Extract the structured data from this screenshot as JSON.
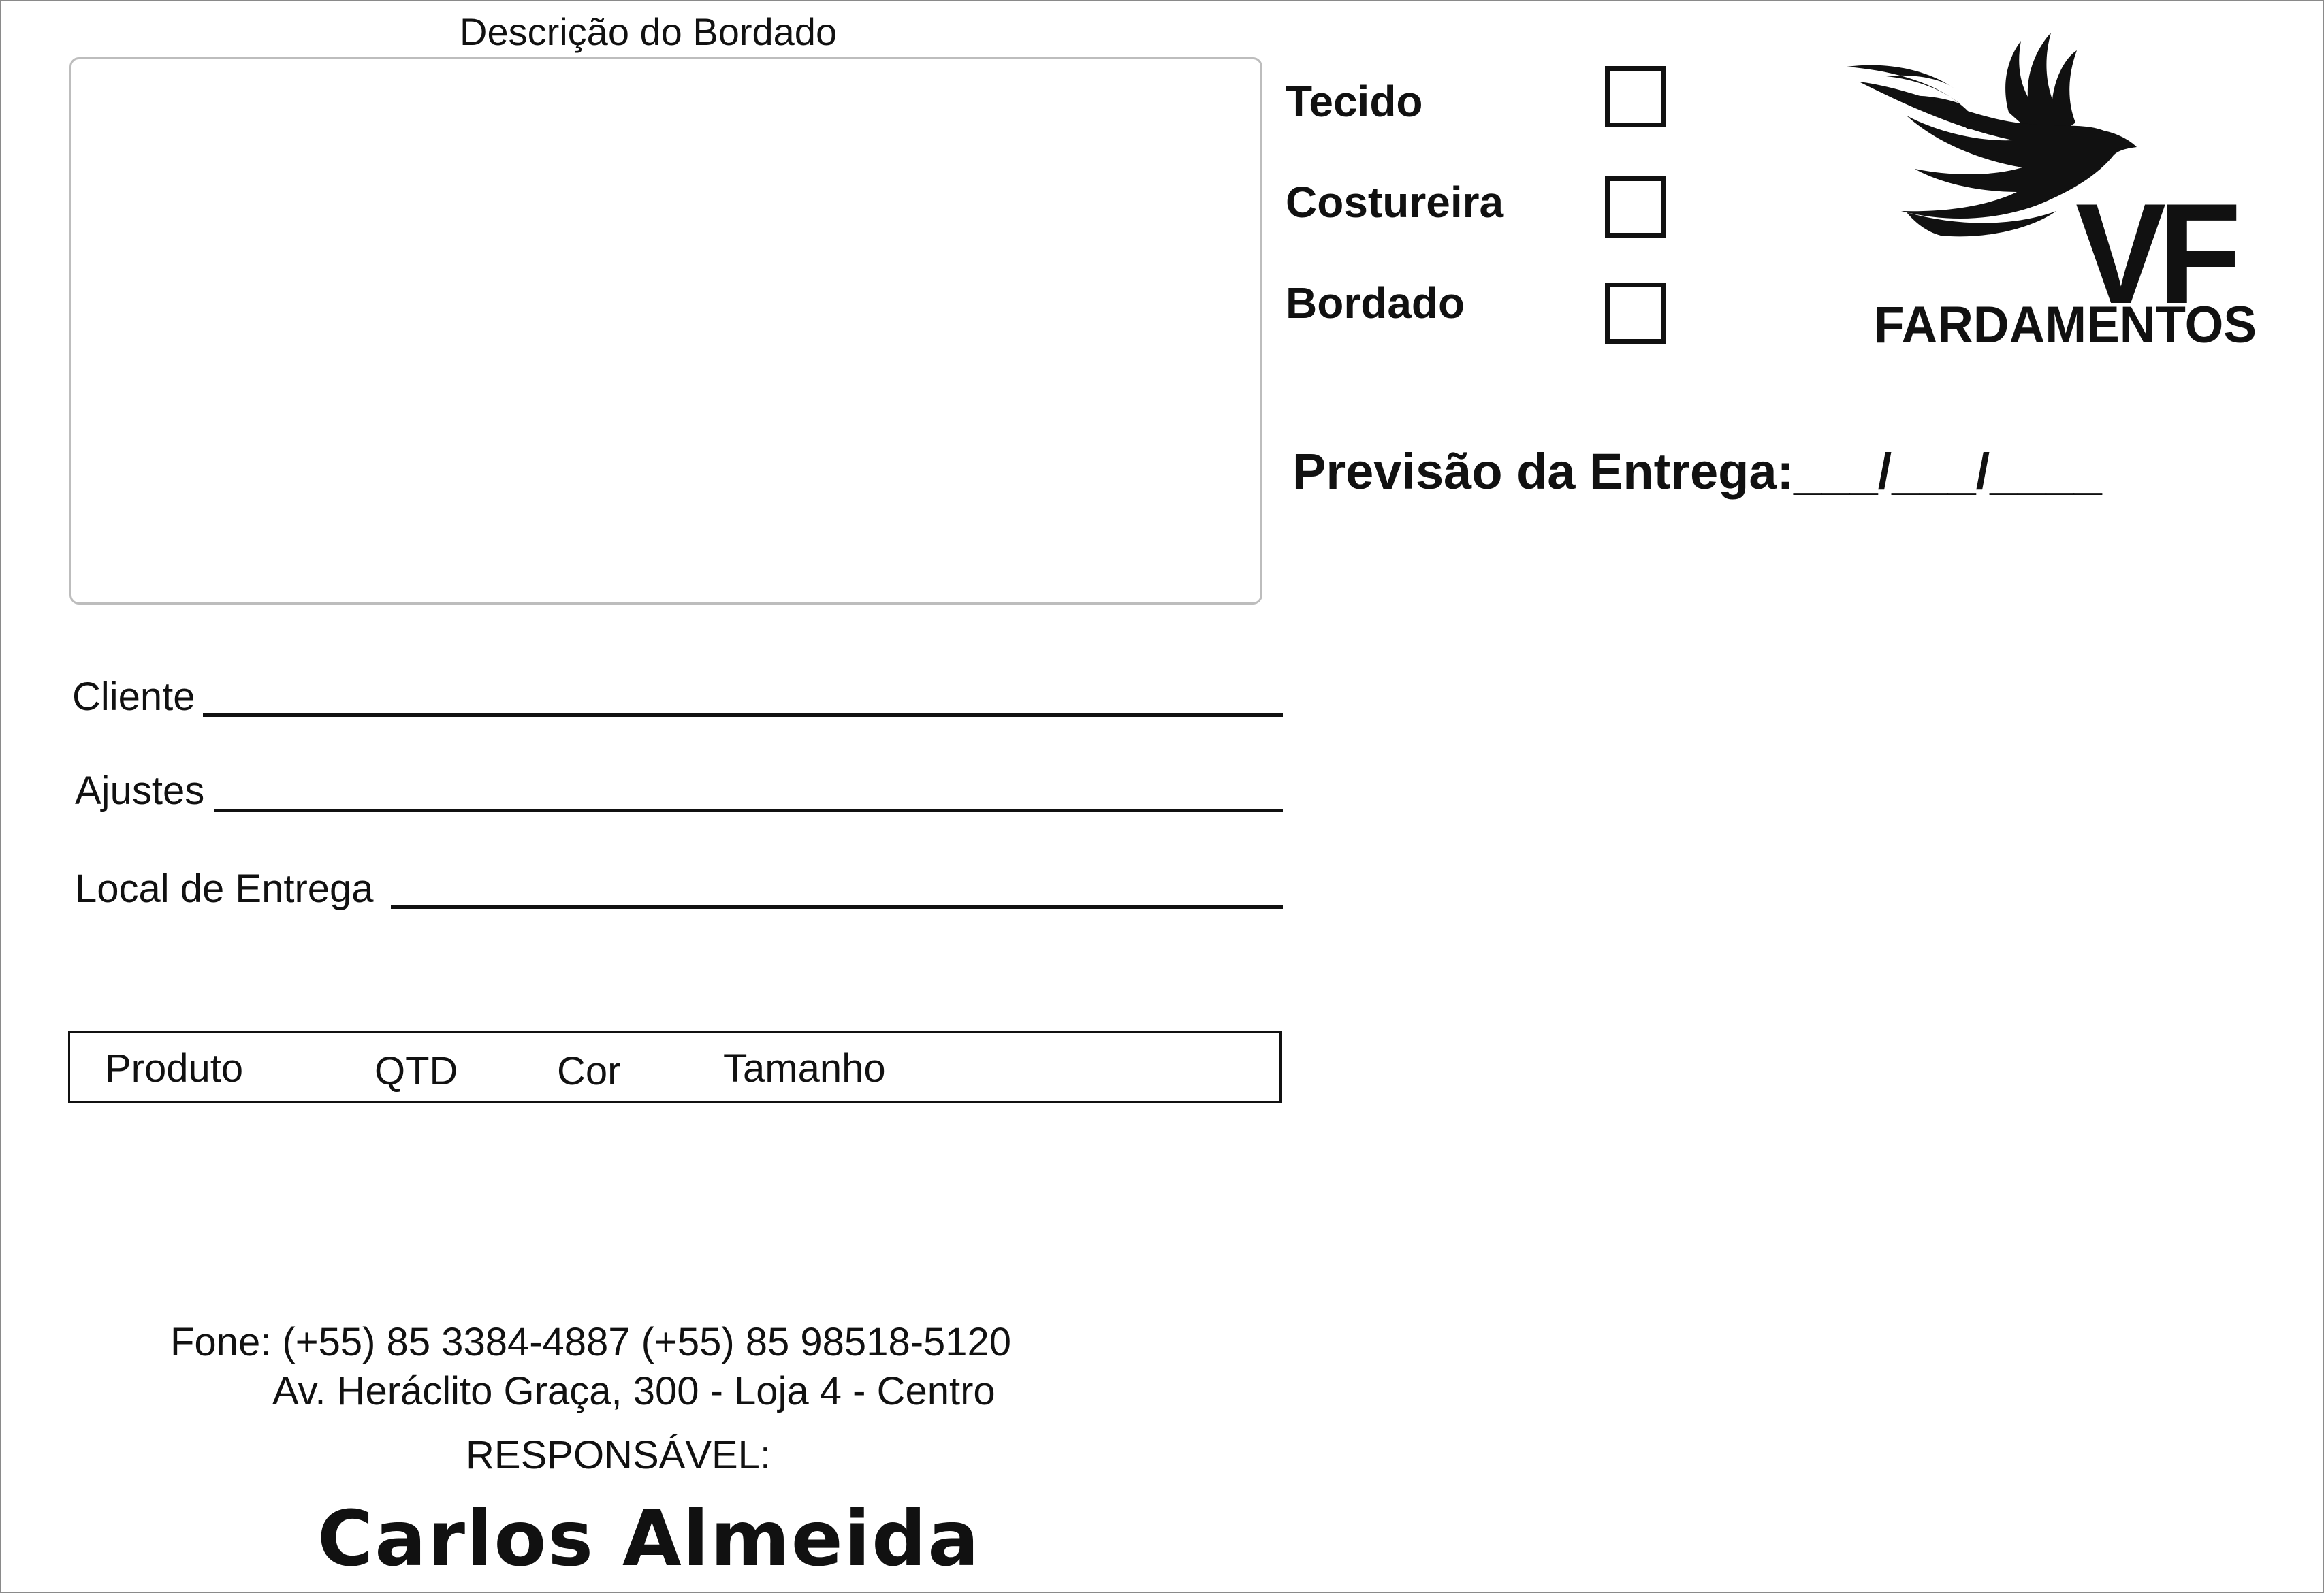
{
  "description": {
    "title": "Descrição do Bordado"
  },
  "checklist": [
    {
      "label": "Tecido",
      "checked": false
    },
    {
      "label": "Costureira",
      "checked": false
    },
    {
      "label": "Bordado",
      "checked": false
    }
  ],
  "logo": {
    "monogram": "VF",
    "name": "FARDAMENTOS",
    "icon": "bird-icon"
  },
  "forecast": {
    "text": "Previsão da Entrega:___/___/____"
  },
  "fields": {
    "client_label": "Cliente",
    "adjustments_label": "Ajustes",
    "delivery_place_label": "Local de Entrega"
  },
  "product_table": {
    "columns": [
      "Produto",
      "QTD",
      "Cor",
      "Tamanho"
    ]
  },
  "footer": {
    "phone": "Fone: (+55) 85 3384-4887 (+55) 85 98518-5120",
    "address": "Av. Heráclito Graça, 300 - Loja 4 - Centro",
    "responsible_label": "RESPONSÁVEL:",
    "responsible_name": "Carlos Almeida"
  },
  "colors": {
    "ink": "#111111",
    "box_border": "#bdbdbd",
    "background": "#ffffff"
  }
}
